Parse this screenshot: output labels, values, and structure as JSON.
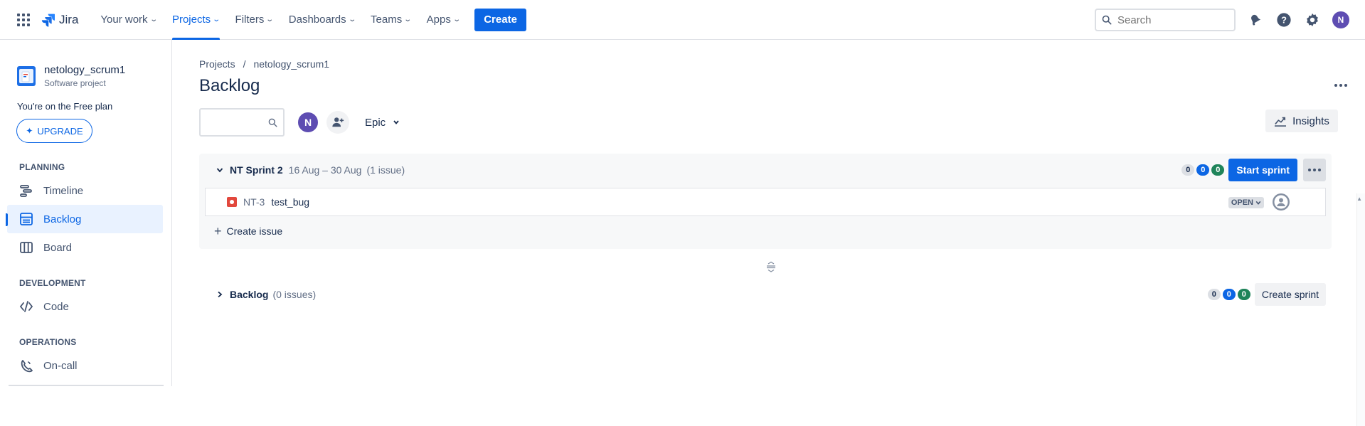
{
  "topnav": {
    "logo_text": "Jira",
    "items": [
      {
        "label": "Your work",
        "active": false
      },
      {
        "label": "Projects",
        "active": true
      },
      {
        "label": "Filters",
        "active": false
      },
      {
        "label": "Dashboards",
        "active": false
      },
      {
        "label": "Teams",
        "active": false
      },
      {
        "label": "Apps",
        "active": false
      }
    ],
    "create_label": "Create",
    "search_placeholder": "Search",
    "avatar_initial": "N",
    "icons": [
      "notifications-icon",
      "help-icon",
      "settings-icon"
    ]
  },
  "sidebar": {
    "project_name": "netology_scrum1",
    "project_type": "Software project",
    "plan_text": "You're on the Free plan",
    "upgrade_label": "UPGRADE",
    "sections": {
      "planning": "PLANNING",
      "development": "DEVELOPMENT",
      "operations": "OPERATIONS"
    },
    "items": {
      "timeline": "Timeline",
      "backlog": "Backlog",
      "board": "Board",
      "code": "Code",
      "oncall": "On-call"
    },
    "active_item": "backlog"
  },
  "main": {
    "breadcrumb": [
      "Projects",
      "netology_scrum1"
    ],
    "breadcrumb_sep": "/",
    "title": "Backlog",
    "toolbar": {
      "avatar_initial": "N",
      "epic_label": "Epic",
      "insights_label": "Insights"
    },
    "sprint": {
      "name": "NT Sprint 2",
      "dates": "16 Aug – 30 Aug",
      "count": "(1 issue)",
      "counters": {
        "todo": "0",
        "in_progress": "0",
        "done": "0"
      },
      "start_label": "Start sprint",
      "issues": [
        {
          "key": "NT-3",
          "summary": "test_bug",
          "status": "OPEN",
          "type": "bug"
        }
      ],
      "create_issue_label": "Create issue"
    },
    "backlog": {
      "title": "Backlog",
      "count": "(0 issues)",
      "counters": {
        "todo": "0",
        "in_progress": "0",
        "done": "0"
      },
      "create_sprint_label": "Create sprint"
    }
  },
  "colors": {
    "accent": "#0c66e4",
    "done": "#1f845a",
    "bug": "#e2483d",
    "avatar": "#5e4db2"
  }
}
